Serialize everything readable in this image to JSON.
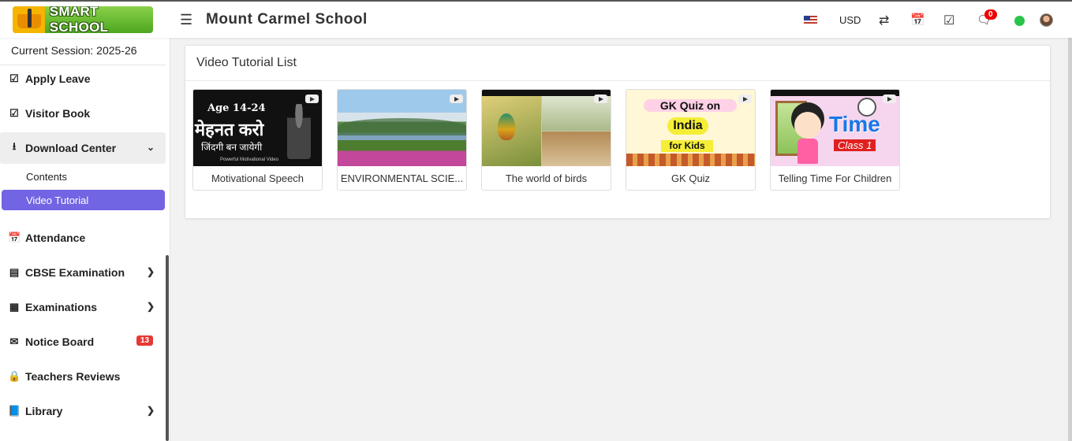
{
  "header": {
    "logo_text": "SMART SCHOOL",
    "school_name": "Mount Carmel School",
    "currency": "USD",
    "chat_count": "0",
    "icons": [
      "hamburger-icon",
      "us-flag-icon",
      "swap-icon",
      "calendar-icon",
      "checkbox-icon",
      "chat-icon",
      "whatsapp-icon",
      "avatar"
    ]
  },
  "sidebar": {
    "session": "Current Session: 2025-26",
    "items": [
      {
        "label": "Apply Leave",
        "icon": "checkbox-icon"
      },
      {
        "label": "Visitor Book",
        "icon": "checkbox-icon"
      },
      {
        "label": "Download Center",
        "icon": "download-icon",
        "expanded": true
      },
      {
        "label": "Attendance",
        "icon": "calendar-check-icon"
      },
      {
        "label": "CBSE Examination",
        "icon": "newspaper-icon"
      },
      {
        "label": "Examinations",
        "icon": "map-icon"
      },
      {
        "label": "Notice Board",
        "icon": "envelope-icon",
        "badge": "13"
      },
      {
        "label": "Teachers Reviews",
        "icon": "user-lock-icon"
      },
      {
        "label": "Library",
        "icon": "book-icon"
      }
    ],
    "download_sub": [
      {
        "label": "Contents"
      },
      {
        "label": "Video Tutorial",
        "active": true
      }
    ]
  },
  "panel": {
    "title": "Video Tutorial List",
    "videos": [
      {
        "label": "Motivational Speech",
        "thumb_age": "Age 14-24",
        "thumb_line1": "मेहनत करो",
        "thumb_line2": "जिंदगी बन जायेगी",
        "thumb_small": "Powerful Motivational Video"
      },
      {
        "label": "ENVIRONMENTAL SCIE..."
      },
      {
        "label": "The world of birds"
      },
      {
        "label": "GK Quiz",
        "thumb_title": "GK Quiz on",
        "thumb_subject": "India",
        "thumb_tag": "for Kids"
      },
      {
        "label": "Telling Time For Children",
        "thumb_title": "Time",
        "thumb_class": "Class 1"
      }
    ]
  },
  "colors": {
    "active_sub": "#7165e3",
    "badge_red": "#e53935",
    "logo_green": "#6cc23a"
  }
}
